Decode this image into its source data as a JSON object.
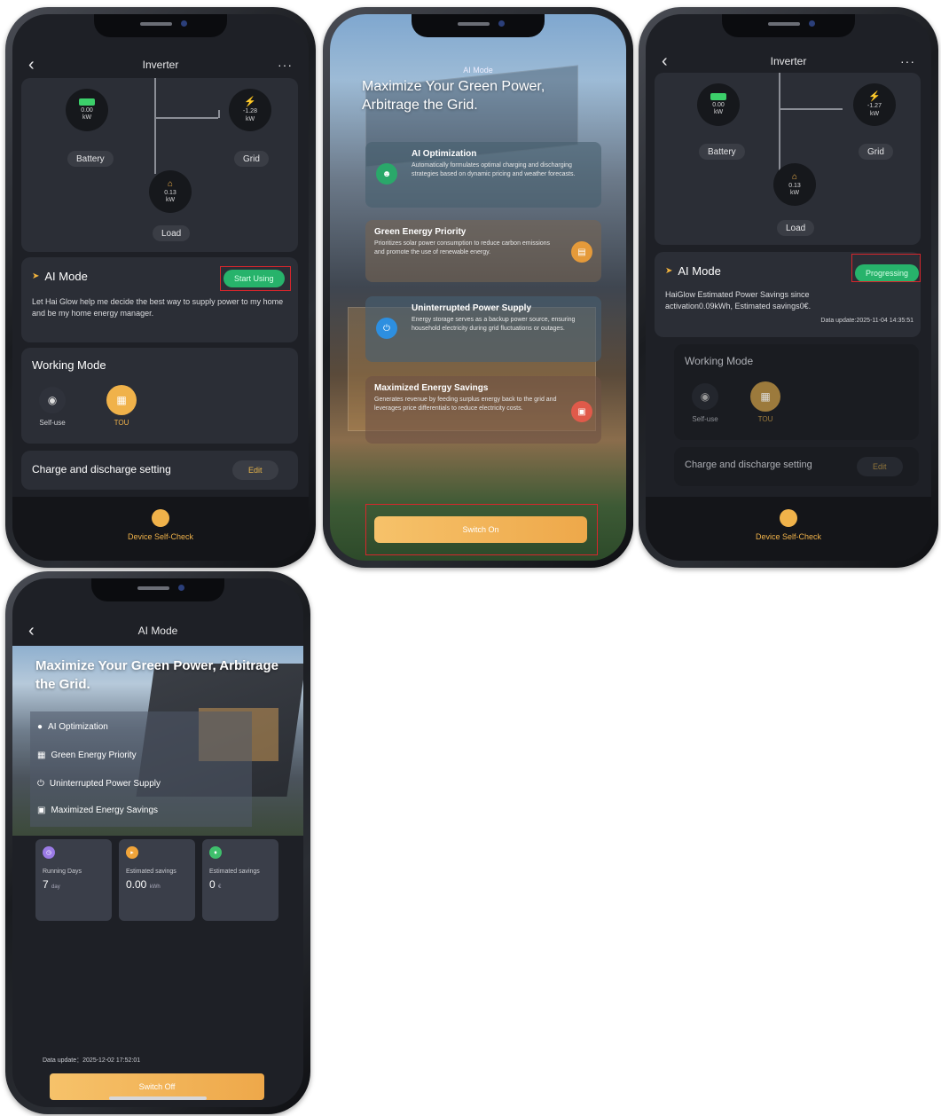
{
  "screen1": {
    "title": "Inverter",
    "battery": {
      "value": "0.00",
      "unit": "kW",
      "label": "Battery"
    },
    "grid": {
      "value": "-1.28",
      "unit": "kW",
      "label": "Grid"
    },
    "load": {
      "value": "0.13",
      "unit": "kW",
      "label": "Load"
    },
    "ai_mode": {
      "title": "AI Mode",
      "button": "Start Using",
      "description": "Let Hai Glow help me decide the best way to supply power to my home and be my home energy manager."
    },
    "working_mode": {
      "title": "Working Mode",
      "modes": [
        {
          "label": "Self-use"
        },
        {
          "label": "TOU"
        }
      ]
    },
    "charge": {
      "label": "Charge and discharge setting",
      "edit": "Edit"
    },
    "self_check": "Device Self-Check"
  },
  "screen2": {
    "title": "AI Mode",
    "headline": "Maximize Your Green Power, Arbitrage the Grid.",
    "features": [
      {
        "title": "AI Optimization",
        "text": "Automatically formulates optimal charging and discharging strategies based on dynamic pricing and weather forecasts."
      },
      {
        "title": "Green Energy Priority",
        "text": "Prioritizes solar power consumption to reduce carbon emissions and promote the use of renewable energy."
      },
      {
        "title": "Uninterrupted Power Supply",
        "text": "Energy storage serves as a backup power source, ensuring household electricity during grid fluctuations or outages."
      },
      {
        "title": "Maximized Energy Savings",
        "text": "Generates revenue by feeding surplus energy back to the grid and leverages price differentials to reduce electricity costs."
      }
    ],
    "button": "Switch On"
  },
  "screen3": {
    "title": "Inverter",
    "battery": {
      "value": "0.00",
      "unit": "kW",
      "label": "Battery"
    },
    "grid": {
      "value": "-1.27",
      "unit": "kW",
      "label": "Grid"
    },
    "load": {
      "value": "0.13",
      "unit": "kW",
      "label": "Load"
    },
    "ai_mode": {
      "title": "AI Mode",
      "button": "Progressing",
      "description": "HaiGlow Estimated Power Savings since activation0.09kWh,  Estimated savings0€.",
      "data_update": "Data update:2025-11-04 14:35:51"
    },
    "working_mode": {
      "title": "Working Mode",
      "modes": [
        {
          "label": "Self-use"
        },
        {
          "label": "TOU"
        }
      ]
    },
    "charge": {
      "label": "Charge and discharge setting",
      "edit": "Edit"
    },
    "self_check": "Device Self-Check"
  },
  "screen4": {
    "title": "AI Mode",
    "headline": "Maximize Your Green Power, Arbitrage the Grid.",
    "features": [
      {
        "title": "AI Optimization"
      },
      {
        "title": "Green Energy Priority"
      },
      {
        "title": "Uninterrupted Power Supply"
      },
      {
        "title": "Maximized Energy Savings"
      }
    ],
    "stats": [
      {
        "label": "Running Days",
        "value": "7",
        "unit": "day",
        "color": "#9b7be6"
      },
      {
        "label": "Estimated savings",
        "value": "0.00",
        "unit": "kWh",
        "color": "#f0a43a"
      },
      {
        "label": "Estimated savings",
        "value": "0",
        "unit": "€",
        "color": "#3fbf6c"
      }
    ],
    "data_update": "Data update：2025-12-02 17:52:01",
    "button": "Switch Off"
  },
  "colors": {
    "accent": "#f0b24a",
    "green": "#27b36b",
    "bg": "#1e2026",
    "card": "#2b2e36",
    "highlight": "#d7262c"
  }
}
